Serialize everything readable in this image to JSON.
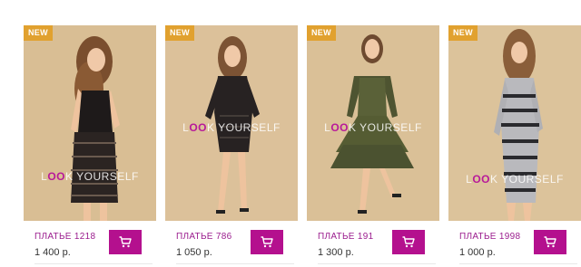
{
  "products": [
    {
      "badge": "NEW",
      "name": "ПЛАТЬЕ 1218",
      "price": "1 400 р.",
      "watermark": {
        "left": "L",
        "o": "OO",
        "right": "K YOURSELF"
      }
    },
    {
      "badge": "NEW",
      "name": "ПЛАТЬЕ 786",
      "price": "1 050 р.",
      "watermark": {
        "left": "L",
        "o": "OO",
        "right": "K YOURSELF"
      }
    },
    {
      "badge": "NEW",
      "name": "ПЛАТЬЕ 191",
      "price": "1 300 р.",
      "watermark": {
        "left": "L",
        "o": "OO",
        "right": "K YOURSELF"
      }
    },
    {
      "badge": "NEW",
      "name": "ПЛАТЬЕ 1998",
      "price": "1 000 р.",
      "watermark": {
        "left": "L",
        "o": "OO",
        "right": "K YOURSELF"
      }
    }
  ],
  "colors": {
    "badge": "#e1a12f",
    "accent": "#b4108e",
    "product_name": "#9b1d8e",
    "photo_background": "#d8bd92"
  },
  "icons": {
    "cart": "shopping-cart-icon"
  }
}
